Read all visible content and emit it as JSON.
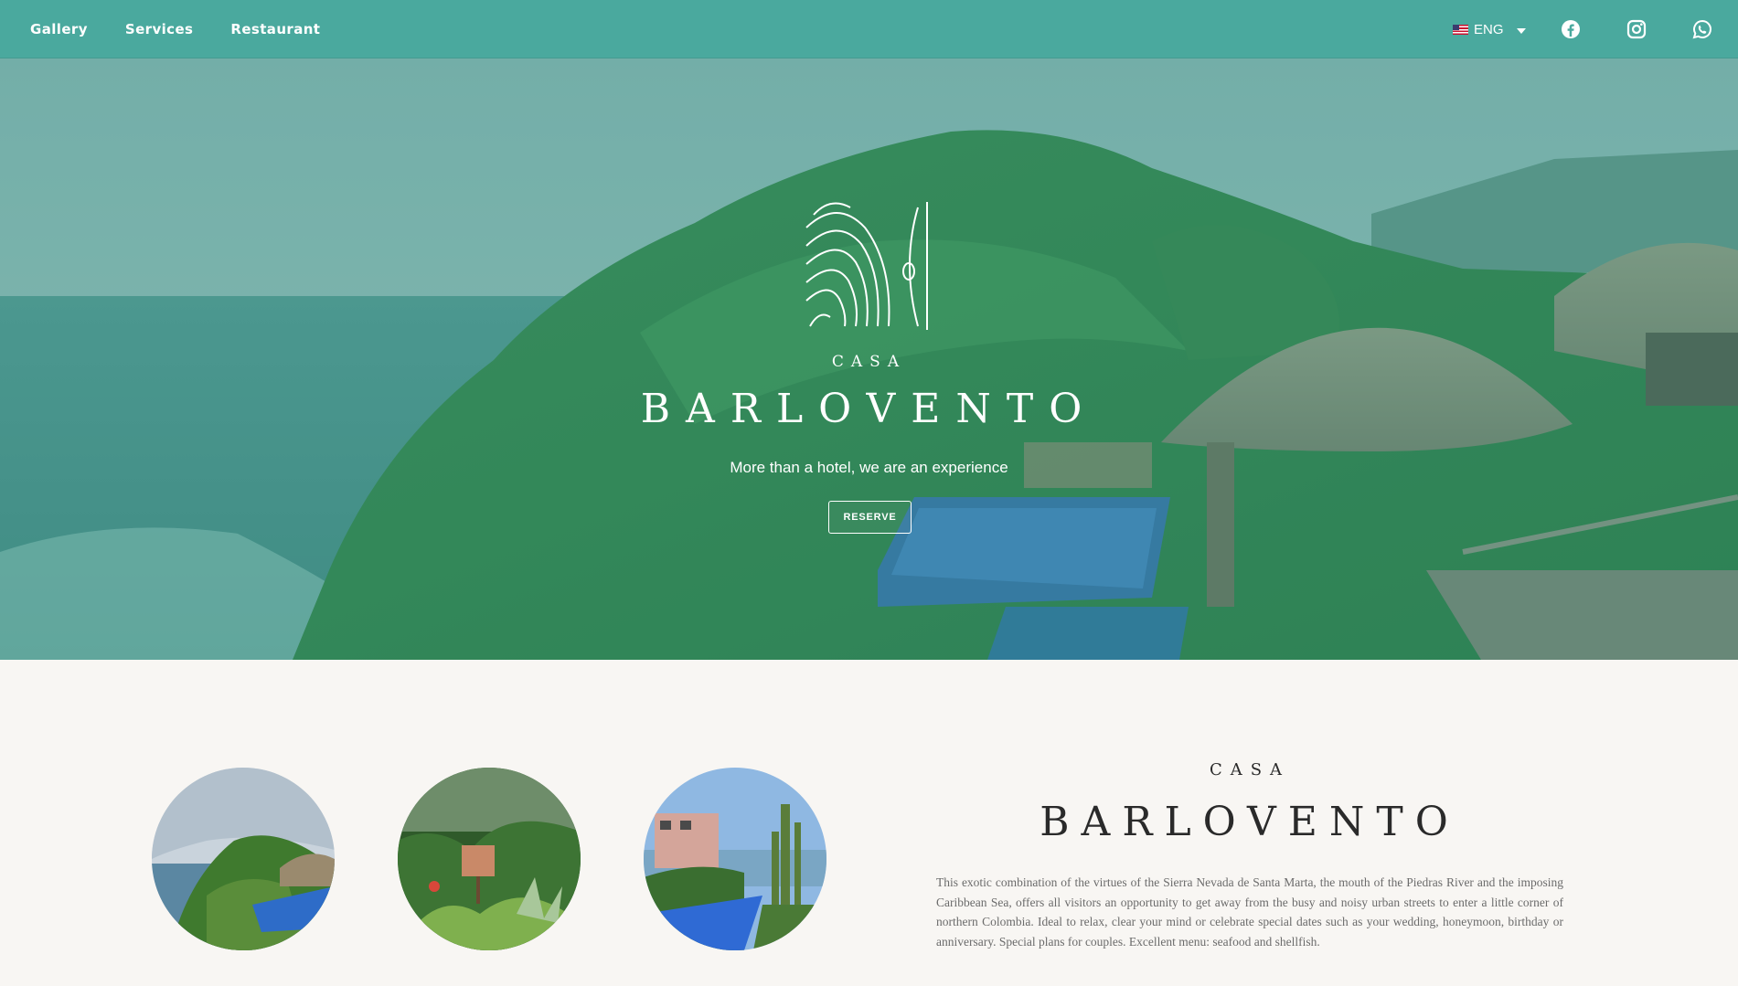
{
  "nav": {
    "links": [
      "Gallery",
      "Services",
      "Restaurant"
    ],
    "language": "ENG",
    "social": [
      "facebook-icon",
      "instagram-icon",
      "whatsapp-icon"
    ]
  },
  "hero": {
    "casa": "CASA",
    "name": "BARLOVENTO",
    "tagline": "More than a hotel, we are an experience",
    "reserve_label": "RESERVE"
  },
  "about": {
    "casa": "CASA",
    "name": "BARLOVENTO",
    "text": "This exotic combination of the virtues of the Sierra Nevada de Santa Marta, the mouth of the Piedras River and the imposing Caribbean Sea, offers all visitors an opportunity to get away from the busy and noisy urban streets to enter a little corner of northern Colombia. Ideal to relax, clear your mind or celebrate special dates such as your wedding, honeymoon, birthday or anniversary. Special plans for couples. Excellent menu: seafood and shellfish."
  },
  "colors": {
    "nav_bg": "#4aa99e",
    "overlay": "#48a896",
    "page_bg": "#f8f6f3"
  }
}
